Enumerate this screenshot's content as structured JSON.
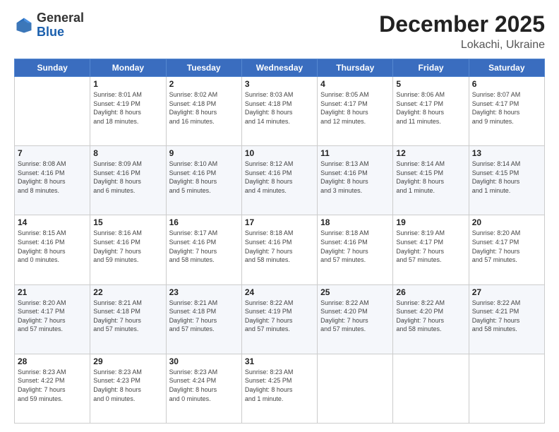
{
  "header": {
    "logo_general": "General",
    "logo_blue": "Blue",
    "month": "December 2025",
    "location": "Lokachi, Ukraine"
  },
  "weekdays": [
    "Sunday",
    "Monday",
    "Tuesday",
    "Wednesday",
    "Thursday",
    "Friday",
    "Saturday"
  ],
  "weeks": [
    [
      {
        "day": "",
        "info": ""
      },
      {
        "day": "1",
        "info": "Sunrise: 8:01 AM\nSunset: 4:19 PM\nDaylight: 8 hours\nand 18 minutes."
      },
      {
        "day": "2",
        "info": "Sunrise: 8:02 AM\nSunset: 4:18 PM\nDaylight: 8 hours\nand 16 minutes."
      },
      {
        "day": "3",
        "info": "Sunrise: 8:03 AM\nSunset: 4:18 PM\nDaylight: 8 hours\nand 14 minutes."
      },
      {
        "day": "4",
        "info": "Sunrise: 8:05 AM\nSunset: 4:17 PM\nDaylight: 8 hours\nand 12 minutes."
      },
      {
        "day": "5",
        "info": "Sunrise: 8:06 AM\nSunset: 4:17 PM\nDaylight: 8 hours\nand 11 minutes."
      },
      {
        "day": "6",
        "info": "Sunrise: 8:07 AM\nSunset: 4:17 PM\nDaylight: 8 hours\nand 9 minutes."
      }
    ],
    [
      {
        "day": "7",
        "info": "Sunrise: 8:08 AM\nSunset: 4:16 PM\nDaylight: 8 hours\nand 8 minutes."
      },
      {
        "day": "8",
        "info": "Sunrise: 8:09 AM\nSunset: 4:16 PM\nDaylight: 8 hours\nand 6 minutes."
      },
      {
        "day": "9",
        "info": "Sunrise: 8:10 AM\nSunset: 4:16 PM\nDaylight: 8 hours\nand 5 minutes."
      },
      {
        "day": "10",
        "info": "Sunrise: 8:12 AM\nSunset: 4:16 PM\nDaylight: 8 hours\nand 4 minutes."
      },
      {
        "day": "11",
        "info": "Sunrise: 8:13 AM\nSunset: 4:16 PM\nDaylight: 8 hours\nand 3 minutes."
      },
      {
        "day": "12",
        "info": "Sunrise: 8:14 AM\nSunset: 4:15 PM\nDaylight: 8 hours\nand 1 minute."
      },
      {
        "day": "13",
        "info": "Sunrise: 8:14 AM\nSunset: 4:15 PM\nDaylight: 8 hours\nand 1 minute."
      }
    ],
    [
      {
        "day": "14",
        "info": "Sunrise: 8:15 AM\nSunset: 4:16 PM\nDaylight: 8 hours\nand 0 minutes."
      },
      {
        "day": "15",
        "info": "Sunrise: 8:16 AM\nSunset: 4:16 PM\nDaylight: 7 hours\nand 59 minutes."
      },
      {
        "day": "16",
        "info": "Sunrise: 8:17 AM\nSunset: 4:16 PM\nDaylight: 7 hours\nand 58 minutes."
      },
      {
        "day": "17",
        "info": "Sunrise: 8:18 AM\nSunset: 4:16 PM\nDaylight: 7 hours\nand 58 minutes."
      },
      {
        "day": "18",
        "info": "Sunrise: 8:18 AM\nSunset: 4:16 PM\nDaylight: 7 hours\nand 57 minutes."
      },
      {
        "day": "19",
        "info": "Sunrise: 8:19 AM\nSunset: 4:17 PM\nDaylight: 7 hours\nand 57 minutes."
      },
      {
        "day": "20",
        "info": "Sunrise: 8:20 AM\nSunset: 4:17 PM\nDaylight: 7 hours\nand 57 minutes."
      }
    ],
    [
      {
        "day": "21",
        "info": "Sunrise: 8:20 AM\nSunset: 4:17 PM\nDaylight: 7 hours\nand 57 minutes."
      },
      {
        "day": "22",
        "info": "Sunrise: 8:21 AM\nSunset: 4:18 PM\nDaylight: 7 hours\nand 57 minutes."
      },
      {
        "day": "23",
        "info": "Sunrise: 8:21 AM\nSunset: 4:18 PM\nDaylight: 7 hours\nand 57 minutes."
      },
      {
        "day": "24",
        "info": "Sunrise: 8:22 AM\nSunset: 4:19 PM\nDaylight: 7 hours\nand 57 minutes."
      },
      {
        "day": "25",
        "info": "Sunrise: 8:22 AM\nSunset: 4:20 PM\nDaylight: 7 hours\nand 57 minutes."
      },
      {
        "day": "26",
        "info": "Sunrise: 8:22 AM\nSunset: 4:20 PM\nDaylight: 7 hours\nand 58 minutes."
      },
      {
        "day": "27",
        "info": "Sunrise: 8:22 AM\nSunset: 4:21 PM\nDaylight: 7 hours\nand 58 minutes."
      }
    ],
    [
      {
        "day": "28",
        "info": "Sunrise: 8:23 AM\nSunset: 4:22 PM\nDaylight: 7 hours\nand 59 minutes."
      },
      {
        "day": "29",
        "info": "Sunrise: 8:23 AM\nSunset: 4:23 PM\nDaylight: 8 hours\nand 0 minutes."
      },
      {
        "day": "30",
        "info": "Sunrise: 8:23 AM\nSunset: 4:24 PM\nDaylight: 8 hours\nand 0 minutes."
      },
      {
        "day": "31",
        "info": "Sunrise: 8:23 AM\nSunset: 4:25 PM\nDaylight: 8 hours\nand 1 minute."
      },
      {
        "day": "",
        "info": ""
      },
      {
        "day": "",
        "info": ""
      },
      {
        "day": "",
        "info": ""
      }
    ]
  ]
}
